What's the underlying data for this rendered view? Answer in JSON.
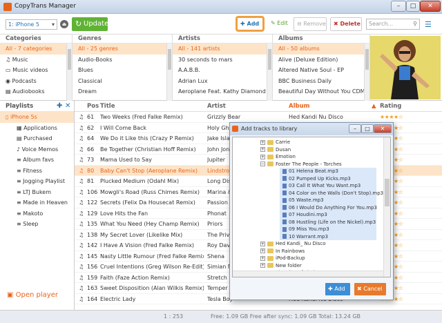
{
  "window": {
    "title": "CopyTrans Manager",
    "min": "–",
    "max": "□",
    "close": "✕"
  },
  "toolbar": {
    "device": "1: iPhone 5",
    "update": "Update",
    "add": "Add",
    "edit": "Edit",
    "remove": "Remove",
    "delete": "Delete",
    "search_placeholder": "Search..."
  },
  "browser": {
    "categories": {
      "header": "Categories",
      "items": [
        "All - 7 categories",
        "Music",
        "Music videos",
        "Podcasts",
        "Audiobooks"
      ]
    },
    "genres": {
      "header": "Genres",
      "items": [
        "All - 25 genres",
        "Audio-Books",
        "Blues",
        "Classical",
        "Dream"
      ]
    },
    "artists": {
      "header": "Artists",
      "items": [
        "All - 141 artists",
        "30 seconds to mars",
        "A.A.B.B.",
        "Adrian Lux",
        "Aeroplane Feat. Kathy Diamond"
      ]
    },
    "albums": {
      "header": "Albums",
      "items": [
        "All - 50 albums",
        "Alive (Deluxe Edition)",
        "Altered Native Soul - EP",
        "BBC Business Daily",
        "Beautiful Day Without You CDM"
      ]
    }
  },
  "playlists": {
    "header": "Playlists",
    "device": "iPhone 5s",
    "items": [
      "Applications",
      "Purchased",
      "Voice Memos",
      "Album favs",
      "Fitness",
      "Jogging Playlist",
      "LTJ Bukem",
      "Made in Heaven",
      "Makoto",
      "Sleep"
    ],
    "open_player": "Open player"
  },
  "tracks": {
    "columns": {
      "pos": "Pos",
      "title": "Title",
      "artist": "Artist",
      "album": "Album",
      "rating": "Rating"
    },
    "rows": [
      {
        "pos": "61",
        "title": "Two Weeks (Fred Falke Remix)",
        "artist": "Grizzly Bear",
        "album": "Hed Kandi Nu Disco",
        "stars": "★★★★☆"
      },
      {
        "pos": "62",
        "title": "I Will Come Back",
        "artist": "Holy Gho",
        "album": "",
        "stars": "★★★★☆"
      },
      {
        "pos": "64",
        "title": "We Do it Like this (Crazy P Remix)",
        "artist": "Jake Isla",
        "album": "",
        "stars": "★★★★☆"
      },
      {
        "pos": "66",
        "title": "Be Together (Christian Hoff Remix)",
        "artist": "John Jon",
        "album": "",
        "stars": "★★★★☆"
      },
      {
        "pos": "73",
        "title": "Mama Used to Say",
        "artist": "Jupiter",
        "album": "",
        "stars": "★★★★☆"
      },
      {
        "pos": "80",
        "title": "Baby Can't Stop (Aeroplane Remix)",
        "artist": "Lindstron",
        "album": "",
        "stars": "★★★★☆"
      },
      {
        "pos": "81",
        "title": "Plucked Medium (Odahl Mix)",
        "artist": "Long Dis",
        "album": "",
        "stars": "★★★★☆"
      },
      {
        "pos": "106",
        "title": "Mowgli's Road (Russ Chimes Remix)",
        "artist": "Marina &",
        "album": "",
        "stars": "★★★★☆"
      },
      {
        "pos": "122",
        "title": "Secrets (Felix Da Housecat Remix)",
        "artist": "Passion",
        "album": "",
        "stars": "★★★★☆"
      },
      {
        "pos": "129",
        "title": "Love Hits the Fan",
        "artist": "Phonat",
        "album": "",
        "stars": "★★★★☆"
      },
      {
        "pos": "135",
        "title": "What You Need (Hey Champ Remix)",
        "artist": "Priors",
        "album": "",
        "stars": "★★★★☆"
      },
      {
        "pos": "138",
        "title": "My Secret Lover (Likelike Mix)",
        "artist": "The Priv",
        "album": "",
        "stars": "★★★★☆"
      },
      {
        "pos": "142",
        "title": "I Have A Vision (Fred Falke Remix)",
        "artist": "Roy Dav",
        "album": "",
        "stars": "★★★★☆"
      },
      {
        "pos": "145",
        "title": "Nasty Little Rumour (Fred Falke Remix)",
        "artist": "Shena",
        "album": "",
        "stars": "★★★★☆"
      },
      {
        "pos": "156",
        "title": "Cruel Intentions (Greg Wilson Re-Edit)",
        "artist": "Simian M",
        "album": "",
        "stars": "★★★★☆"
      },
      {
        "pos": "159",
        "title": "Faith (Faze Action Remix)",
        "artist": "Stretch S",
        "album": "",
        "stars": "★★★★☆"
      },
      {
        "pos": "163",
        "title": "Sweet Disposition (Alan Wilkis Remix)",
        "artist": "Temper",
        "album": "",
        "stars": "★★★★☆"
      },
      {
        "pos": "164",
        "title": "Electric Lady",
        "artist": "Tesla Boy",
        "album": "Hed Kandi Nu Disco",
        "stars": "★★★★☆"
      }
    ]
  },
  "status": {
    "count": "1 : 253",
    "free": "Free: 1.09 GB Free after sync: 1.09 GB Total: 13.24 GB"
  },
  "dialog": {
    "title": "Add tracks to library",
    "tree": [
      {
        "label": "Carrie",
        "type": "folder"
      },
      {
        "label": "Dusan",
        "type": "folder"
      },
      {
        "label": "Emotion",
        "type": "folder"
      },
      {
        "label": "Foster The People - Torches",
        "type": "open"
      },
      {
        "label": "01 Helena Beat.mp3",
        "type": "file"
      },
      {
        "label": "02 Pumped Up Kicks.mp3",
        "type": "file"
      },
      {
        "label": "03 Call It What You Want.mp3",
        "type": "file"
      },
      {
        "label": "04 Color on the Walls (Don't Stop).mp3",
        "type": "file"
      },
      {
        "label": "05 Waste.mp3",
        "type": "file"
      },
      {
        "label": "06 I Would Do Anything For You.mp3",
        "type": "file"
      },
      {
        "label": "07 Houdini.mp3",
        "type": "file"
      },
      {
        "label": "08 Hustling (Life on the Nickel).mp3",
        "type": "file"
      },
      {
        "label": "09 Miss You.mp3",
        "type": "file"
      },
      {
        "label": "10 Warrant.mp3",
        "type": "file"
      },
      {
        "label": "Hed Kandi_ Nu Disco",
        "type": "folder"
      },
      {
        "label": "In Rainbows",
        "type": "folder"
      },
      {
        "label": "iPod-Backup",
        "type": "folder"
      },
      {
        "label": "New folder",
        "type": "folder"
      },
      {
        "label": "The King of Limbs",
        "type": "folder"
      }
    ],
    "add": "Add",
    "cancel": "Cancel"
  },
  "colors": {
    "accent": "#e8641c",
    "blue": "#1f73b5",
    "green": "#5fb334",
    "selection": "#fde4c8"
  }
}
